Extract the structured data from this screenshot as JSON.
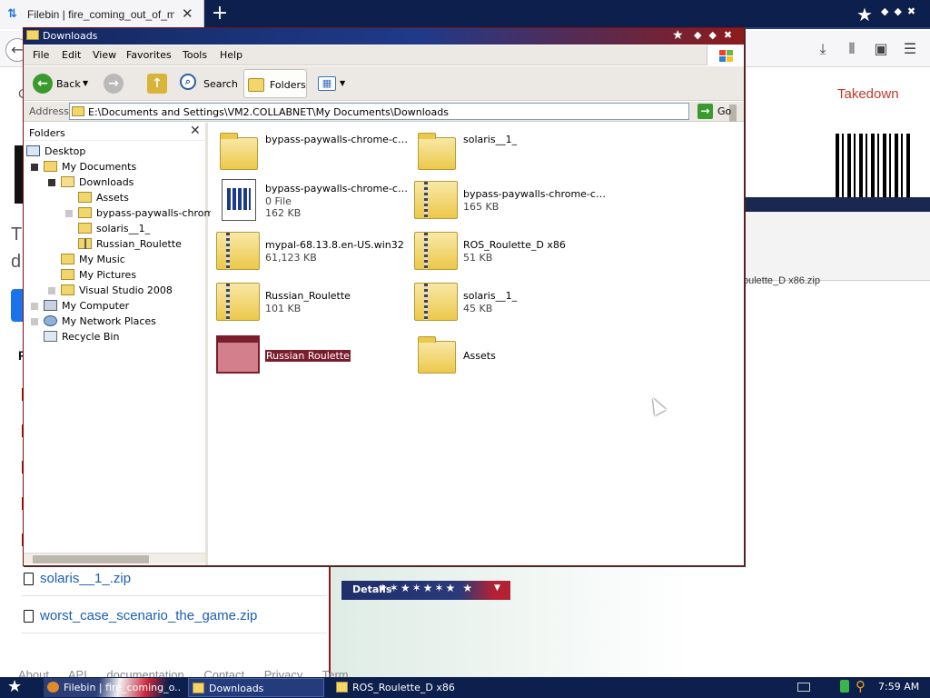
{
  "browser": {
    "tab_title": "Filebin | fire_coming_out_of_monitor",
    "tab_close": "✕",
    "new_tab": "+",
    "takedown": "Takedown",
    "page_letter_c": "C",
    "page_letter_t": "T",
    "page_letter_d": "d",
    "page_letter_f": "F",
    "file_label_right": "oulette_D x86.zip",
    "file_links": [
      "solaris__1_.zip",
      "worst_case_scenario_the_game.zip"
    ],
    "details_label": "Details",
    "footer": "About API documentation Contact Privacy Term"
  },
  "explorer": {
    "title": "Downloads",
    "menu": [
      "File",
      "Edit",
      "View",
      "Favorites",
      "Tools",
      "Help"
    ],
    "toolbar": {
      "back": "Back",
      "search": "Search",
      "folders": "Folders"
    },
    "address_label": "Address",
    "address_value": "E:\\Documents and Settings\\VM2.COLLABNET\\My Documents\\Downloads",
    "go": "Go",
    "folders_pane_title": "Folders",
    "tree": [
      {
        "label": "Desktop",
        "icon": "desktop-icon"
      },
      {
        "label": "My Documents",
        "icon": "folder-icon"
      },
      {
        "label": "Downloads",
        "icon": "folder-open-icon"
      },
      {
        "label": "Assets",
        "icon": "folder-icon"
      },
      {
        "label": "bypass-paywalls-chrome-",
        "icon": "folder-icon"
      },
      {
        "label": "solaris__1_",
        "icon": "folder-icon"
      },
      {
        "label": "Russian_Roulette",
        "icon": "zip-folder-icon"
      },
      {
        "label": "My Music",
        "icon": "folder-icon"
      },
      {
        "label": "My Pictures",
        "icon": "folder-icon"
      },
      {
        "label": "Visual Studio 2008",
        "icon": "folder-icon"
      },
      {
        "label": "My Computer",
        "icon": "computer-icon"
      },
      {
        "label": "My Network Places",
        "icon": "network-icon"
      },
      {
        "label": "Recycle Bin",
        "icon": "recycle-bin-icon"
      }
    ],
    "files": [
      {
        "name": "bypass-paywalls-chrome-clea...",
        "meta1": "",
        "meta2": "",
        "icon": "folder-icon"
      },
      {
        "name": "solaris__1_",
        "meta1": "",
        "meta2": "",
        "icon": "folder-icon"
      },
      {
        "name": "bypass-paywalls-chrome-clea...",
        "meta1": "0 File",
        "meta2": "162 KB",
        "icon": "document-icon"
      },
      {
        "name": "bypass-paywalls-chrome-clea...",
        "meta1": "165 KB",
        "meta2": "",
        "icon": "zip-folder-icon"
      },
      {
        "name": "mypal-68.13.8.en-US.win32",
        "meta1": "61,123 KB",
        "meta2": "",
        "icon": "zip-folder-icon"
      },
      {
        "name": "ROS_Roulette_D x86",
        "meta1": "51 KB",
        "meta2": "",
        "icon": "zip-folder-icon"
      },
      {
        "name": "Russian_Roulette",
        "meta1": "101 KB",
        "meta2": "",
        "icon": "zip-folder-icon"
      },
      {
        "name": "solaris__1_",
        "meta1": "45 KB",
        "meta2": "",
        "icon": "zip-folder-icon"
      },
      {
        "name": "Russian Roulette",
        "meta1": "",
        "meta2": "",
        "icon": "application-icon"
      },
      {
        "name": "Assets",
        "meta1": "",
        "meta2": "",
        "icon": "folder-icon"
      }
    ]
  },
  "taskbar": {
    "tasks": [
      "Filebin | fire_coming_o...",
      "Downloads",
      "ROS_Roulette_D x86"
    ],
    "clock": "7:59 AM"
  },
  "colors": {
    "titlebar_blue": "#14285f",
    "titlebar_red": "#8e1b1b",
    "selection": "#7a1e2e",
    "link_blue": "#1a5fb4",
    "takedown_red": "#c0392b"
  }
}
